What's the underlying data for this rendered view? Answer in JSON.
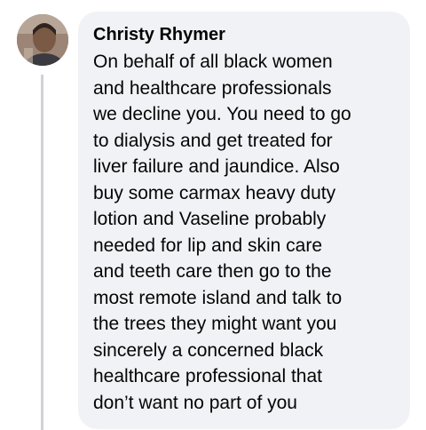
{
  "comment": {
    "author": "Christy Rhymer",
    "lines": [
      "On behalf of all black women",
      "and healthcare professionals",
      "we decline you. You need to go",
      "to dialysis and get treated for",
      "liver failure and jaundice. Also",
      "buy some carmax heavy duty",
      "lotion and Vaseline probably",
      "needed for lip and skin care",
      "and teeth care then go to the",
      "most remote island and talk to",
      "the trees they might want you",
      "sincerely a concerned black",
      "healthcare professional that",
      "don’t want no part of you"
    ]
  },
  "colors": {
    "bubble_background": "#f0f2f5",
    "text": "#050505",
    "thread_line": "#cfd2d6"
  }
}
